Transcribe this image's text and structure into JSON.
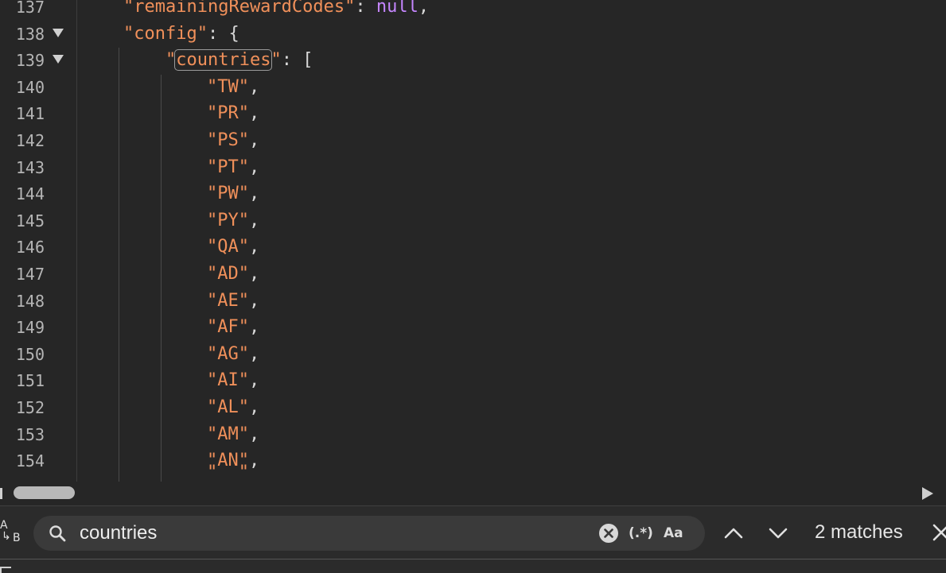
{
  "editor": {
    "lines": [
      {
        "num": "137",
        "fold": false,
        "tokens": [
          {
            "t": "\"remainingRewardCodes\"",
            "c": "str"
          },
          {
            "t": ": ",
            "c": "pun"
          },
          {
            "t": "null",
            "c": "nul"
          },
          {
            "t": ",",
            "c": "pun"
          }
        ]
      },
      {
        "num": "138",
        "fold": true,
        "tokens": [
          {
            "t": "\"config\"",
            "c": "str"
          },
          {
            "t": ": {",
            "c": "pun"
          }
        ]
      },
      {
        "num": "139",
        "fold": true,
        "tokens": [
          {
            "t": "\"",
            "c": "str"
          },
          {
            "t": "countries",
            "c": "str hl"
          },
          {
            "t": "\"",
            "c": "str"
          },
          {
            "t": ": [",
            "c": "pun"
          }
        ]
      },
      {
        "num": "140",
        "fold": false,
        "tokens": [
          {
            "t": "\"TW\"",
            "c": "str"
          },
          {
            "t": ",",
            "c": "pun"
          }
        ]
      },
      {
        "num": "141",
        "fold": false,
        "tokens": [
          {
            "t": "\"PR\"",
            "c": "str"
          },
          {
            "t": ",",
            "c": "pun"
          }
        ]
      },
      {
        "num": "142",
        "fold": false,
        "tokens": [
          {
            "t": "\"PS\"",
            "c": "str"
          },
          {
            "t": ",",
            "c": "pun"
          }
        ]
      },
      {
        "num": "143",
        "fold": false,
        "tokens": [
          {
            "t": "\"PT\"",
            "c": "str"
          },
          {
            "t": ",",
            "c": "pun"
          }
        ]
      },
      {
        "num": "144",
        "fold": false,
        "tokens": [
          {
            "t": "\"PW\"",
            "c": "str"
          },
          {
            "t": ",",
            "c": "pun"
          }
        ]
      },
      {
        "num": "145",
        "fold": false,
        "tokens": [
          {
            "t": "\"PY\"",
            "c": "str"
          },
          {
            "t": ",",
            "c": "pun"
          }
        ]
      },
      {
        "num": "146",
        "fold": false,
        "tokens": [
          {
            "t": "\"QA\"",
            "c": "str"
          },
          {
            "t": ",",
            "c": "pun"
          }
        ]
      },
      {
        "num": "147",
        "fold": false,
        "tokens": [
          {
            "t": "\"AD\"",
            "c": "str"
          },
          {
            "t": ",",
            "c": "pun"
          }
        ]
      },
      {
        "num": "148",
        "fold": false,
        "tokens": [
          {
            "t": "\"AE\"",
            "c": "str"
          },
          {
            "t": ",",
            "c": "pun"
          }
        ]
      },
      {
        "num": "149",
        "fold": false,
        "tokens": [
          {
            "t": "\"AF\"",
            "c": "str"
          },
          {
            "t": ",",
            "c": "pun"
          }
        ]
      },
      {
        "num": "150",
        "fold": false,
        "tokens": [
          {
            "t": "\"AG\"",
            "c": "str"
          },
          {
            "t": ",",
            "c": "pun"
          }
        ]
      },
      {
        "num": "151",
        "fold": false,
        "tokens": [
          {
            "t": "\"AI\"",
            "c": "str"
          },
          {
            "t": ",",
            "c": "pun"
          }
        ]
      },
      {
        "num": "152",
        "fold": false,
        "tokens": [
          {
            "t": "\"AL\"",
            "c": "str"
          },
          {
            "t": ",",
            "c": "pun"
          }
        ]
      },
      {
        "num": "153",
        "fold": false,
        "tokens": [
          {
            "t": "\"AM\"",
            "c": "str"
          },
          {
            "t": ",",
            "c": "pun"
          }
        ]
      },
      {
        "num": "154",
        "fold": false,
        "tokens": [
          {
            "t": "\"AN\"",
            "c": "str"
          },
          {
            "t": ",",
            "c": "pun"
          }
        ]
      }
    ]
  },
  "find": {
    "query": "countries",
    "match_count": "2 matches",
    "toggle_regex_label": "(.*)",
    "toggle_case_label": "Aa",
    "icons": [
      "search-icon",
      "clear-icon",
      "regex-toggle-icon",
      "match-case-icon",
      "chevron-up-icon",
      "chevron-down-icon",
      "close-icon"
    ]
  }
}
